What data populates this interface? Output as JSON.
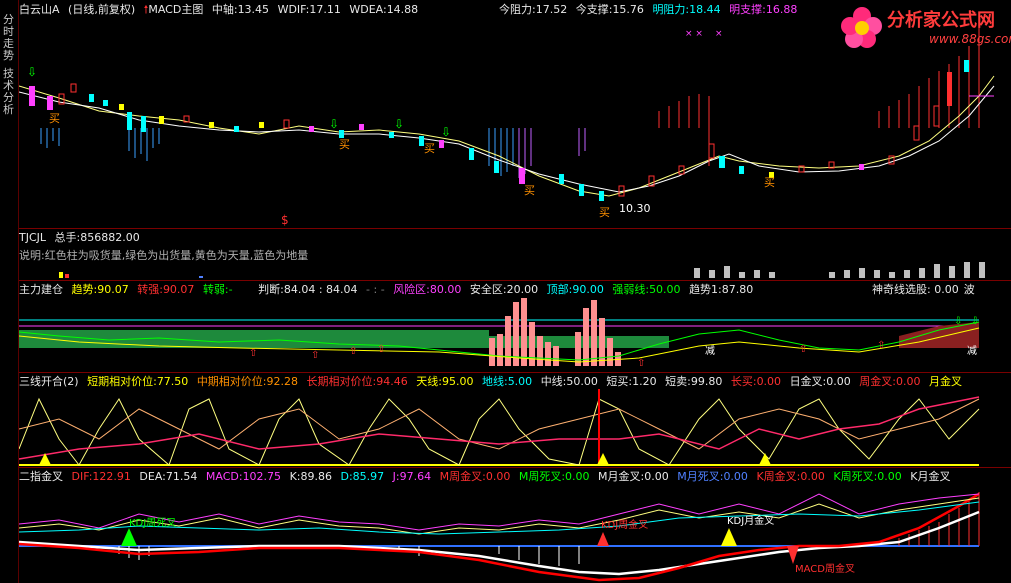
{
  "sidebar": {
    "tabs": [
      "分时走势",
      "技术分析"
    ]
  },
  "header": {
    "stock": "白云山",
    "stock_flag": "A",
    "period": "(日线,前复权)",
    "indicator": "MACD主图",
    "fields": [
      {
        "label": "中轴:",
        "value": "13.45"
      },
      {
        "label": "WDIF:",
        "value": "17.11"
      },
      {
        "label": "WDEA:",
        "value": "14.88"
      }
    ],
    "right": [
      {
        "label": "今阻力:",
        "value": "17.52"
      },
      {
        "label": "今支撑:",
        "value": "15.76"
      },
      {
        "label": "明阻力:",
        "value": "18.44"
      },
      {
        "label": "明支撑:",
        "value": "16.88"
      }
    ]
  },
  "logo": {
    "title": "分析家公式网",
    "url": "www.88gs.com"
  },
  "main_chart": {
    "buy_labels": [
      "买",
      "买",
      "买",
      "买",
      "买",
      "买"
    ],
    "price_note": "10.30",
    "marks": [
      "$"
    ]
  },
  "panel1": {
    "title": "TJCJL",
    "total_label": "总手:",
    "total_value": "856882.00",
    "note": "说明:红色柱为吸货量,绿色为出货量,黄色为天量,蓝色为地量"
  },
  "panel2": {
    "title": "主力建仓",
    "fields": [
      {
        "label": "趋势:",
        "value": "90.07",
        "color": "yellow"
      },
      {
        "label": "转强:",
        "value": "90.07",
        "color": "red"
      },
      {
        "label": "转弱:",
        "value": "-",
        "color": "green"
      },
      {
        "label": "判断:",
        "value": "84.04 : 84.04",
        "color": "white"
      },
      {
        "label": "- : -",
        "value": "",
        "color": "gray"
      },
      {
        "label": "风险区:",
        "value": "80.00",
        "color": "mag"
      },
      {
        "label": "安全区:",
        "value": "20.00",
        "color": "white"
      },
      {
        "label": "顶部:",
        "value": "90.00",
        "color": "cyan"
      },
      {
        "label": "强弱线:",
        "value": "50.00",
        "color": "green"
      },
      {
        "label": "趋势1:",
        "value": "87.80",
        "color": "white"
      }
    ],
    "right_label": "神奇线选股: 0.00",
    "right_tail": "波",
    "chart_labels": [
      "减",
      "减"
    ]
  },
  "panel3": {
    "title": "三线开合(2)",
    "fields": [
      {
        "label": "短期相对价位:",
        "value": "77.50",
        "color": "yellow"
      },
      {
        "label": "中期相对价位:",
        "value": "92.28",
        "color": "orange"
      },
      {
        "label": "长期相对价位:",
        "value": "94.46",
        "color": "red"
      },
      {
        "label": "天线:",
        "value": "95.00",
        "color": "yellow"
      },
      {
        "label": "地线:",
        "value": "5.00",
        "color": "cyan"
      },
      {
        "label": "中线:",
        "value": "50.00",
        "color": "white"
      },
      {
        "label": "短买:",
        "value": "1.20",
        "color": "white"
      },
      {
        "label": "短卖:",
        "value": "99.80",
        "color": "white"
      },
      {
        "label": "长买:",
        "value": "0.00",
        "color": "red"
      },
      {
        "label": "日金叉:",
        "value": "0.00",
        "color": "white"
      },
      {
        "label": "周金叉:",
        "value": "0.00",
        "color": "red"
      },
      {
        "label": "月金叉",
        "value": "",
        "color": "yellow"
      }
    ]
  },
  "panel4": {
    "title": "二指金叉",
    "fields": [
      {
        "label": "DIF:",
        "value": "122.91",
        "color": "red"
      },
      {
        "label": "DEA:",
        "value": "71.54",
        "color": "white"
      },
      {
        "label": "MACD:",
        "value": "102.75",
        "color": "mag"
      },
      {
        "label": "K:",
        "value": "89.86",
        "color": "white"
      },
      {
        "label": "D:",
        "value": "85.97",
        "color": "cyan"
      },
      {
        "label": "J:",
        "value": "97.64",
        "color": "mag"
      },
      {
        "label": "M周金叉:",
        "value": "0.00",
        "color": "red"
      },
      {
        "label": "M周死叉:",
        "value": "0.00",
        "color": "green"
      },
      {
        "label": "M月金叉:",
        "value": "0.00",
        "color": "white"
      },
      {
        "label": "M月死叉:",
        "value": "0.00",
        "color": "blue"
      },
      {
        "label": "K周金叉:",
        "value": "0.00",
        "color": "red"
      },
      {
        "label": "K周死叉:",
        "value": "0.00",
        "color": "green"
      },
      {
        "label": "K月金叉",
        "value": "",
        "color": "white"
      }
    ],
    "chart_labels": [
      "KDJ周死叉",
      "KDJ周金叉",
      "KDJ月金叉",
      "MACD周金叉"
    ]
  },
  "colors": {
    "up": "#ff3030",
    "down": "#00ffff",
    "bg": "#000000",
    "grid": "#7a0000"
  }
}
